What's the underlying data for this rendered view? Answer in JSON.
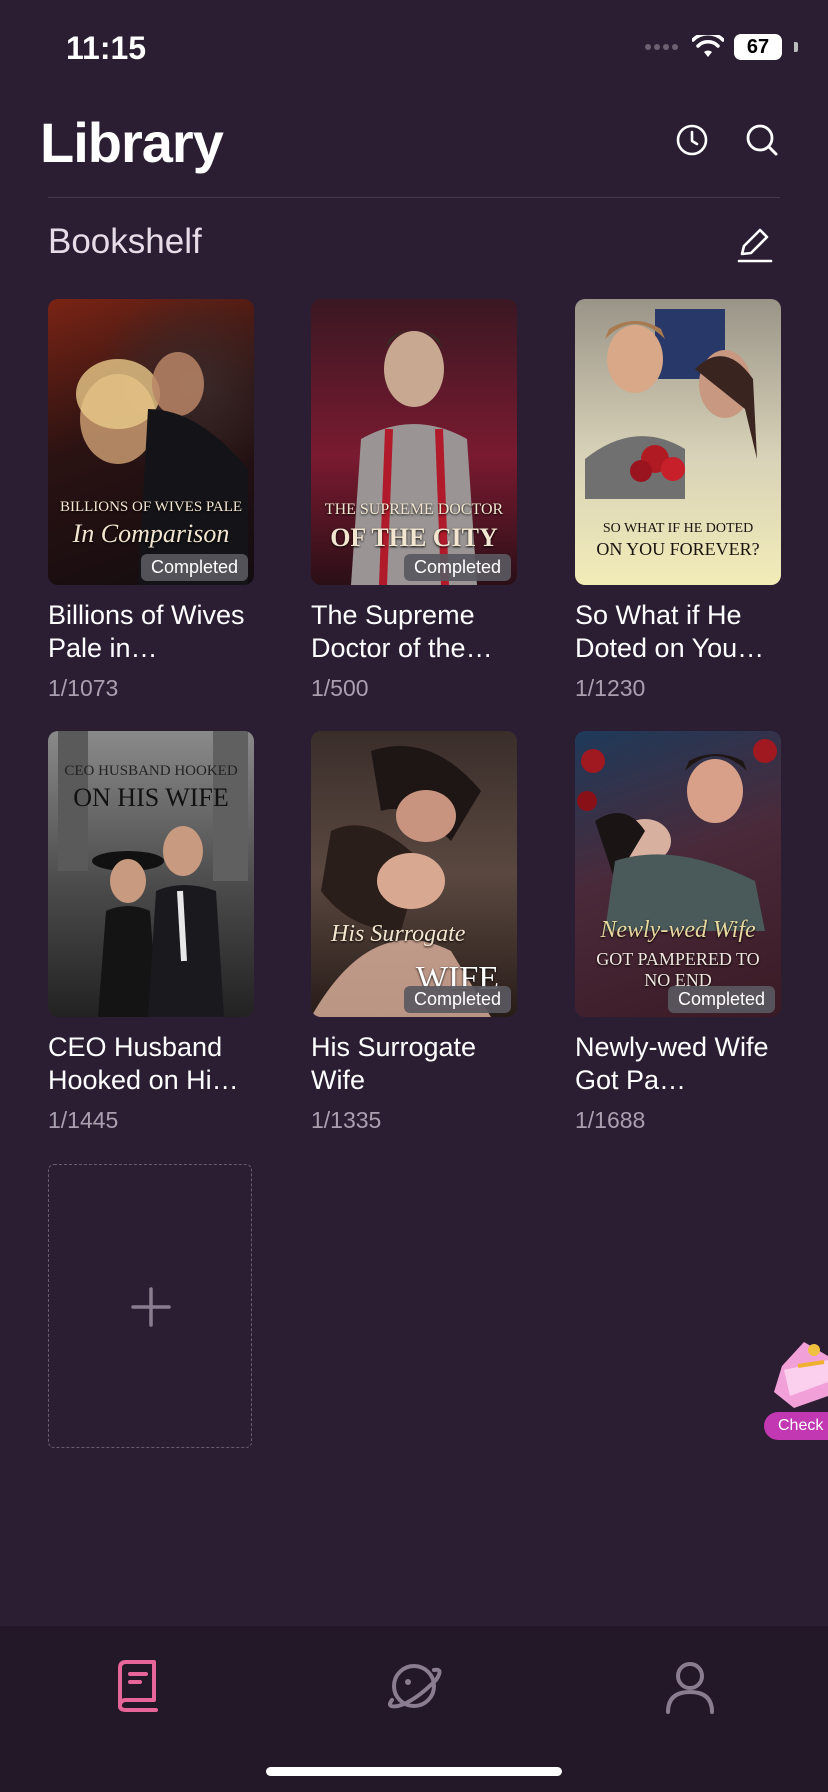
{
  "status": {
    "time": "11:15",
    "battery": "67"
  },
  "header": {
    "title": "Library"
  },
  "bookshelf": {
    "title": "Bookshelf"
  },
  "books": [
    {
      "cover_line1": "BILLIONS OF WIVES PALE",
      "cover_line2": "In Comparison",
      "title": "Billions of Wives Pale in…",
      "progress": "1/1073",
      "badge": "Completed"
    },
    {
      "cover_line1": "THE SUPREME DOCTOR",
      "cover_line2": "OF THE CITY",
      "title": "The Supreme Doctor of the…",
      "progress": "1/500",
      "badge": "Completed"
    },
    {
      "cover_line1": "SO WHAT IF HE DOTED",
      "cover_line2": "ON YOU FOREVER?",
      "title": "So What if He Doted on You…",
      "progress": "1/1230",
      "badge": ""
    },
    {
      "cover_line1": "CEO HUSBAND HOOKED",
      "cover_line2": "ON HIS WIFE",
      "title": "CEO Husband Hooked on Hi…",
      "progress": "1/1445",
      "badge": ""
    },
    {
      "cover_line1": "His Surrogate",
      "cover_line2": "WIFE",
      "title": "His Surrogate Wife",
      "progress": "1/1335",
      "badge": "Completed"
    },
    {
      "cover_line1": "Newly-wed Wife",
      "cover_line2": "GOT PAMPERED TO NO END",
      "title": "Newly-wed Wife Got Pa…",
      "progress": "1/1688",
      "badge": "Completed"
    }
  ],
  "checkin": {
    "label": "Check"
  },
  "colors": {
    "background": "#2b1e33",
    "tab_active": "#e8659a",
    "tab_inactive": "#8a7d90",
    "badge_bg": "#5a5860"
  },
  "icons": [
    "history-icon",
    "search-icon",
    "edit-icon",
    "plus-icon",
    "library-tab-icon",
    "discover-tab-icon",
    "profile-tab-icon"
  ]
}
